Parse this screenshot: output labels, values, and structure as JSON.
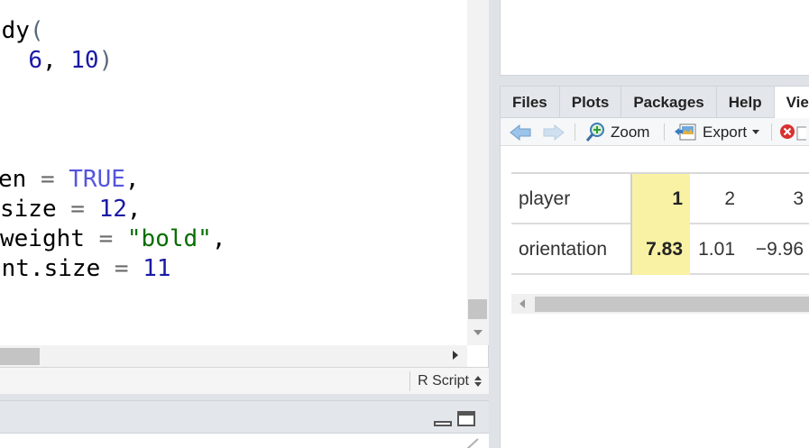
{
  "editor": {
    "lines": [
      {
        "pre": "",
        "a": "ody",
        "b": "(",
        "c": "",
        "d": ""
      },
      {
        "pre": "  ",
        "a": "6",
        "b": ", ",
        "c": "10",
        "d": ")"
      }
    ],
    "line3": {
      "name": "en",
      "op": " = ",
      "val": "TRUE",
      "tail": ","
    },
    "line4": {
      "name": "size",
      "op": " = ",
      "val": "12",
      "tail": ","
    },
    "line5": {
      "name": "weight",
      "op": " = ",
      "val": "\"bold\"",
      "tail": ","
    },
    "line6": {
      "name": "ont.size",
      "op": " = ",
      "val": "11",
      "tail": ""
    },
    "file_type": "R Script"
  },
  "viewer": {
    "tabs": [
      "Files",
      "Plots",
      "Packages",
      "Help",
      "Viewer"
    ],
    "active_tab": "Viewer",
    "toolbar": {
      "zoom_label": "Zoom",
      "export_label": "Export"
    },
    "table": {
      "row1": {
        "label": "player",
        "values": [
          "1",
          "2",
          "3"
        ]
      },
      "row2": {
        "label": "orientation",
        "values": [
          "7.83",
          "1.01",
          "−9.96"
        ]
      }
    },
    "highlight_color": "#f9f2a5"
  },
  "icons": {
    "back": "arrow-left-icon",
    "forward": "arrow-right-icon",
    "zoom": "magnifier-plus-icon",
    "export": "export-image-icon",
    "clear": "clear-red-x-icon",
    "minimize": "minimize-pane-icon",
    "maximize": "maximize-pane-icon",
    "brush": "broom-icon"
  }
}
